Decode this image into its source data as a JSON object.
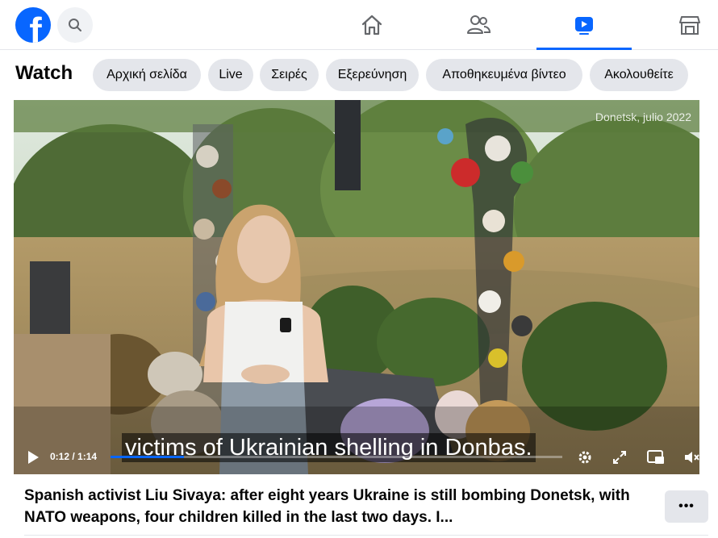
{
  "topbar": {
    "logo_letter": "f",
    "icons": [
      "home-icon",
      "friends-icon",
      "watch-icon",
      "marketplace-icon"
    ],
    "accent": "#0866ff"
  },
  "watch": {
    "title": "Watch",
    "tabs": [
      "Αρχική σελίδα",
      "Live",
      "Σειρές",
      "Εξερεύνηση",
      "Αποθηκευμένα βίντεο",
      "Ακολουθείτε"
    ]
  },
  "video": {
    "watermark": "Donetsk, julio 2022",
    "subtitle": "victims of Ukrainian shelling in Donbas.",
    "time": "0:12 / 1:14",
    "progress_fraction": 0.162
  },
  "post": {
    "caption": "Spanish activist Liu Sivaya: after eight years Ukraine is still bombing Donetsk, with NATO weapons, four children killed in the last two days. I...",
    "more_label": "•••"
  }
}
